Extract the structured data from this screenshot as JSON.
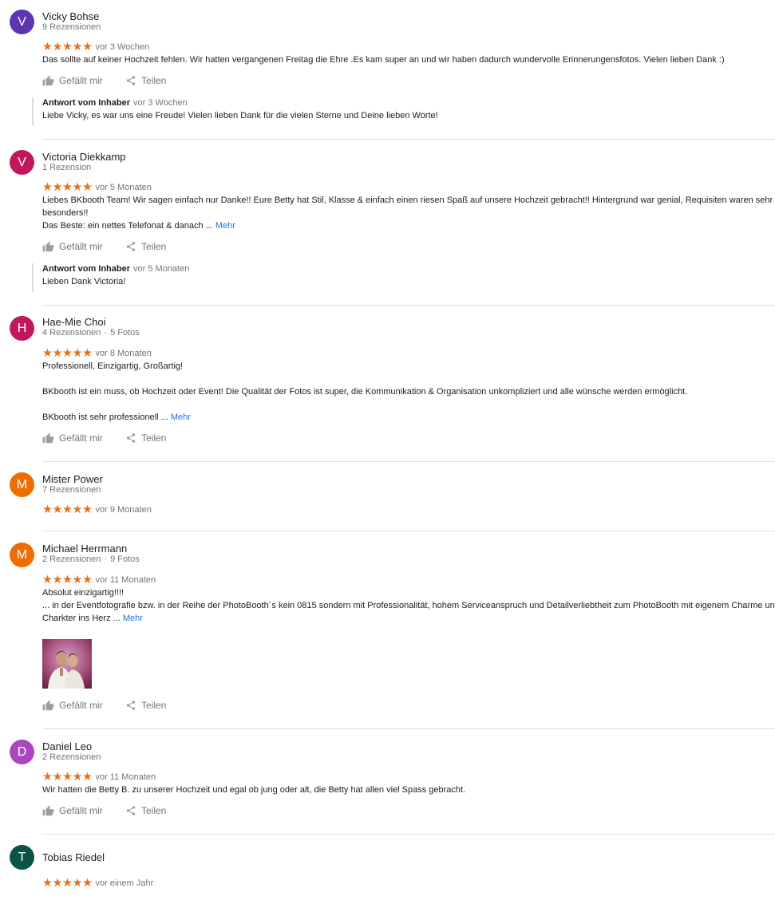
{
  "actions": {
    "like": "Gefällt mir",
    "share": "Teilen"
  },
  "more_label": "Mehr",
  "stars": "★★★★★",
  "reviews": [
    {
      "initial": "V",
      "avatar_color": "#5e35b1",
      "name": "Vicky Bohse",
      "meta": "9 Rezensionen",
      "date": "vor 3 Wochen",
      "text": [
        "Das sollte auf keiner Hochzeit fehlen. Wir hatten vergangenen Freitag die Ehre .Es kam super an und wir haben dadurch wundervolle Erinnerungensfotos. Vielen lieben Dank :)"
      ],
      "owner": {
        "label": "Antwort vom Inhaber",
        "date": "vor 3 Wochen",
        "text": "Liebe Vicky, es war uns eine Freude! Vielen lieben Dank für die vielen Sterne und Deine lieben Worte!"
      }
    },
    {
      "initial": "V",
      "avatar_color": "#c2185b",
      "name": "Victoria Diekkamp",
      "meta": "1 Rezension",
      "date": "vor 5 Monaten",
      "text": [
        "Liebes BKbooth Team! Wir sagen einfach nur Danke!! Eure Betty hat Stil, Klasse & einfach einen riesen Spaß auf unsere Hochzeit gebracht!! Hintergrund war genial, Requisiten waren sehr",
        "besonders!!",
        "Das Beste: ein nettes Telefonat & danach ..."
      ],
      "owner": {
        "label": "Antwort vom Inhaber",
        "date": "vor 5 Monaten",
        "text": "Lieben Dank Victoria!"
      }
    },
    {
      "initial": "H",
      "avatar_color": "#c2185b",
      "name": "Hae-Mie Choi",
      "meta": "4 Rezensionen",
      "meta2": "5 Fotos",
      "date": "vor 8 Monaten",
      "text": [
        "Professionell, Einzigartig, Großartig!",
        "",
        "BKbooth ist ein muss, ob Hochzeit oder Event! Die Qualität der Fotos ist super, die Kommunikation & Organisation unkompliziert und alle wünsche werden ermöglicht.",
        "",
        "BKbooth ist sehr professionell ..."
      ]
    },
    {
      "initial": "M",
      "avatar_color": "#ef6c00",
      "name": "Mister Power",
      "meta": "7 Rezensionen",
      "date": "vor 9 Monaten"
    },
    {
      "initial": "M",
      "avatar_color": "#ef6c00",
      "name": "Michael Herrmann",
      "meta": "2 Rezensionen",
      "meta2": "9 Fotos",
      "date": "vor 11 Monaten",
      "text": [
        "Absolut einzigartig!!!!",
        "... in der Eventfotografie bzw. in der Reihe der PhotoBooth´s kein 0815 sondern mit  Professionalität, hohem Serviceanspruch und Detailverliebtheit zum PhotoBooth mit eigenem Charme und",
        "Charkter ins Herz ..."
      ]
    },
    {
      "initial": "D",
      "avatar_color": "#ab47bc",
      "name": "Daniel Leo",
      "meta": "2 Rezensionen",
      "date": "vor 11 Monaten",
      "text": [
        "Wir hatten die Betty B. zu unserer Hochzeit und egal ob jung oder alt, die Betty hat allen viel Spass gebracht."
      ]
    },
    {
      "initial": "T",
      "avatar_color": "#0b5345",
      "name": "Tobias Riedel",
      "date": "vor einem Jahr"
    }
  ]
}
